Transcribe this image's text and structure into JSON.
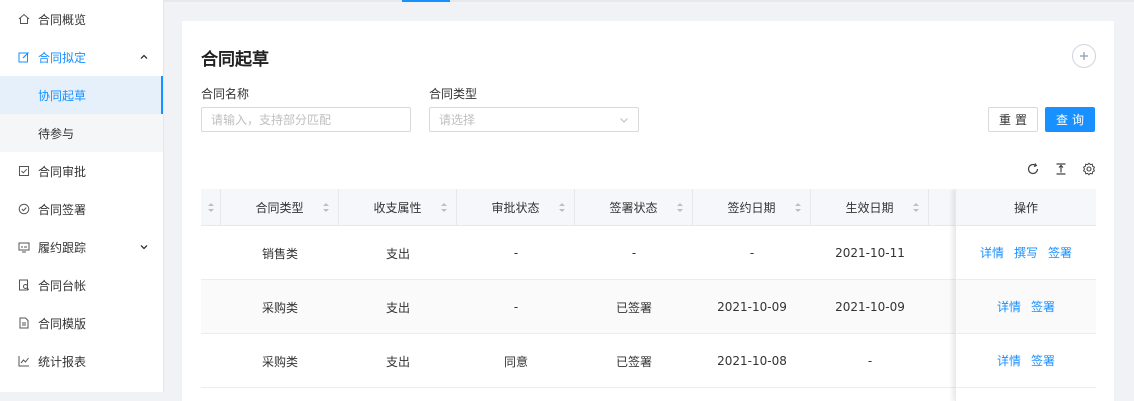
{
  "sidebar": {
    "items": [
      {
        "label": "合同概览",
        "icon": "home-icon"
      },
      {
        "label": "合同拟定",
        "icon": "edit-icon",
        "expanded": true
      },
      {
        "label": "合同审批",
        "icon": "check-square-icon"
      },
      {
        "label": "合同签署",
        "icon": "check-circle-icon"
      },
      {
        "label": "履约跟踪",
        "icon": "monitor-icon"
      },
      {
        "label": "合同台帐",
        "icon": "ledger-icon"
      },
      {
        "label": "合同模版",
        "icon": "file-icon"
      },
      {
        "label": "统计报表",
        "icon": "line-chart-icon"
      }
    ],
    "subitems": [
      {
        "label": "协同起草",
        "active": true
      },
      {
        "label": "待参与"
      }
    ]
  },
  "page": {
    "title": "合同起草"
  },
  "filters": {
    "name_label": "合同名称",
    "name_placeholder": "请输入，支持部分匹配",
    "type_label": "合同类型",
    "type_placeholder": "请选择",
    "reset_label": "重置",
    "query_label": "查询"
  },
  "table": {
    "columns": [
      "合同类型",
      "收支属性",
      "审批状态",
      "签署状态",
      "签约日期",
      "生效日期"
    ],
    "ops_header": "操作",
    "rows": [
      {
        "cells": [
          "销售类",
          "支出",
          "-",
          "-",
          "-",
          "2021-10-11"
        ],
        "ops": [
          "详情",
          "撰写",
          "签署"
        ]
      },
      {
        "cells": [
          "采购类",
          "支出",
          "-",
          "已签署",
          "2021-10-09",
          "2021-10-09"
        ],
        "ops": [
          "详情",
          "签署"
        ]
      },
      {
        "cells": [
          "采购类",
          "支出",
          "同意",
          "已签署",
          "2021-10-08",
          "-"
        ],
        "ops": [
          "详情",
          "签署"
        ]
      }
    ]
  },
  "colors": {
    "accent": "#1890ff",
    "sidebar_active_bg": "#e6f0fb",
    "page_bg": "#f0f2f5"
  }
}
